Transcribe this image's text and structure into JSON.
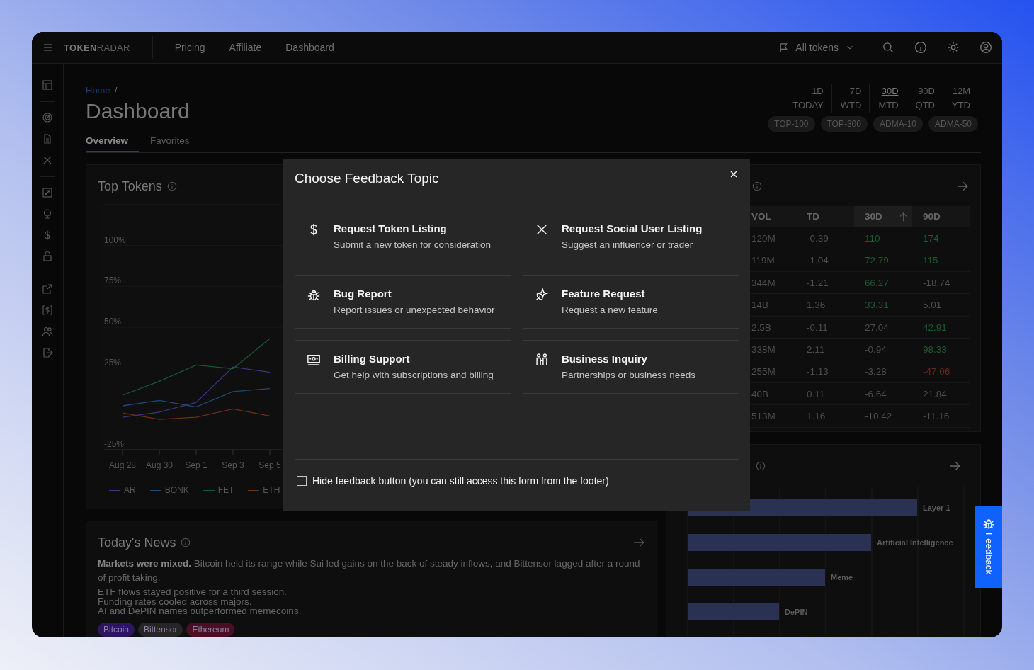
{
  "nav": {
    "brand_bold": "TOKEN",
    "brand_light": "RADAR",
    "links": [
      "Pricing",
      "Affiliate",
      "Dashboard"
    ],
    "token_filter": "All tokens"
  },
  "breadcrumb": {
    "home": "Home",
    "separator": "/"
  },
  "page_title": "Dashboard",
  "tabs": [
    {
      "label": "Overview",
      "selected": true
    },
    {
      "label": "Favorites",
      "selected": false
    }
  ],
  "periods": [
    {
      "short": "1D",
      "long": "TODAY",
      "selected": false
    },
    {
      "short": "7D",
      "long": "WTD",
      "selected": false
    },
    {
      "short": "30D",
      "long": "MTD",
      "selected": true
    },
    {
      "short": "90D",
      "long": "QTD",
      "selected": false
    },
    {
      "short": "12M",
      "long": "YTD",
      "selected": false
    }
  ],
  "lists": [
    "TOP-100",
    "TOP-300",
    "ADMA-10",
    "ADMA-50"
  ],
  "top_tokens": {
    "title": "Top Tokens",
    "chart_data": {
      "type": "line",
      "categories": [
        "Aug 28",
        "Aug 30",
        "Sep 1",
        "Sep 3",
        "Sep 5"
      ],
      "ylim": [
        -25,
        125
      ],
      "grid": true,
      "yticks": [
        {
          "value": -25,
          "label": "-25%"
        },
        {
          "value": 25,
          "label": "25%"
        },
        {
          "value": 50,
          "label": "50%"
        },
        {
          "value": 75,
          "label": "75%"
        },
        {
          "value": 100,
          "label": "100%"
        }
      ],
      "series": [
        {
          "name": "AR",
          "color": "#3b3585",
          "values": [
            -5.1,
            -2,
            4,
            25.7,
            22.4
          ]
        },
        {
          "name": "BONK",
          "color": "#1d4a70",
          "values": [
            1.9,
            5.2,
            1.2,
            10.6,
            12.4
          ]
        },
        {
          "name": "FET",
          "color": "#135a33",
          "values": [
            8.4,
            16.9,
            26.9,
            24.6,
            43.1
          ]
        },
        {
          "name": "ETH",
          "color": "#6a3018",
          "values": [
            -2.5,
            -6.4,
            -5.1,
            0,
            -4.3
          ]
        }
      ]
    }
  },
  "ranking_table": {
    "columns": [
      {
        "label": "VOL",
        "sorted": false
      },
      {
        "label": "TD",
        "sorted": false
      },
      {
        "label": "30D",
        "sorted": true
      },
      {
        "label": "90D",
        "sorted": false
      }
    ],
    "rows": [
      {
        "cells": [
          {
            "text": "120M"
          },
          {
            "text": "-0.39"
          },
          {
            "text": "110",
            "color": "#1b5a2f"
          },
          {
            "text": "174",
            "color": "#1b5a2f"
          }
        ]
      },
      {
        "cells": [
          {
            "text": "119M"
          },
          {
            "text": "-1.04"
          },
          {
            "text": "72.79",
            "color": "#1b5a2f"
          },
          {
            "text": "115",
            "color": "#1b5a2f"
          }
        ]
      },
      {
        "cells": [
          {
            "text": "344M"
          },
          {
            "text": "-1.21"
          },
          {
            "text": "66.27",
            "color": "#1b5a2f"
          },
          {
            "text": "-18.74"
          }
        ]
      },
      {
        "cells": [
          {
            "text": "14B"
          },
          {
            "text": "1.36"
          },
          {
            "text": "33.31",
            "color": "#1b5a2f"
          },
          {
            "text": "5.01"
          }
        ]
      },
      {
        "cells": [
          {
            "text": "2.5B"
          },
          {
            "text": "-0.11"
          },
          {
            "text": "27.04"
          },
          {
            "text": "42.91",
            "color": "#1b5a2f"
          }
        ]
      },
      {
        "cells": [
          {
            "text": "338M"
          },
          {
            "text": "2.11"
          },
          {
            "text": "-0.94"
          },
          {
            "text": "98.33",
            "color": "#1b5a2f"
          }
        ]
      },
      {
        "cells": [
          {
            "text": "255M"
          },
          {
            "text": "-1.13"
          },
          {
            "text": "-3.28"
          },
          {
            "text": "-47.06",
            "color": "#6e2323"
          }
        ]
      },
      {
        "cells": [
          {
            "text": "40B"
          },
          {
            "text": "0.11"
          },
          {
            "text": "-6.64"
          },
          {
            "text": "21.84"
          }
        ]
      },
      {
        "cells": [
          {
            "text": "513M"
          },
          {
            "text": "1.16"
          },
          {
            "text": "-10.42"
          },
          {
            "text": "-11.16"
          }
        ]
      }
    ]
  },
  "sector_chart": {
    "labels": [
      "Layer 1",
      "Artificial Intelligence",
      "Meme",
      "DePIN"
    ]
  },
  "news": {
    "title": "Today's News",
    "summary": "**Markets were mixed.** Bitcoin held its range while Sui led gains on the back of steady inflows, and Bittensor lagged after a round of profit taking.",
    "points": [
      "ETF flows stayed positive for a third session.",
      "Funding rates cooled across majors.",
      "AI and DePIN names outperformed memecoins."
    ],
    "tags": [
      {
        "label": "Bitcoin",
        "color": "#2d1563"
      },
      {
        "label": "Bittensor",
        "color": "#262626"
      },
      {
        "label": "Ethereum",
        "color": "#4a0f22"
      }
    ]
  },
  "feedback_dialog": {
    "title": "Choose Feedback Topic",
    "topics": [
      {
        "title": "Request Token Listing",
        "description": "Submit a new token for consideration"
      },
      {
        "title": "Request Social User Listing",
        "description": "Suggest an influencer or trader"
      },
      {
        "title": "Bug Report",
        "description": "Report issues or unexpected behavior"
      },
      {
        "title": "Feature Request",
        "description": "Request a new feature"
      },
      {
        "title": "Billing Support",
        "description": "Get help with subscriptions and billing"
      },
      {
        "title": "Business Inquiry",
        "description": "Partnerships or business needs"
      }
    ],
    "hide_option": {
      "label": "Hide feedback button (you can still access this form from the footer)",
      "checked": false
    }
  },
  "feedback_tab": {
    "label": "Feedback"
  }
}
